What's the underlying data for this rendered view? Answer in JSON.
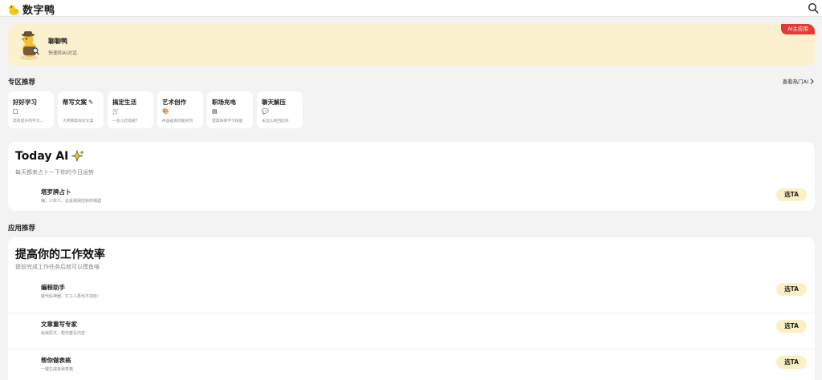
{
  "header": {
    "brand": "数字鸭",
    "logo_icon": "duck-logo-icon",
    "search_icon": "search-icon"
  },
  "banner": {
    "title": "聊聊鸭",
    "subtitle": "快速和AI对话",
    "badge": "AI主应用",
    "avatar_icon": "duck-detective-avatar",
    "background": "#fbf1cf",
    "badge_color": "#e53935"
  },
  "zones_section": {
    "title": "专区推荐",
    "see_more": "查看热门AI",
    "items": [
      {
        "title": "好好学习",
        "icon": "□",
        "desc": "高效提升的学习..."
      },
      {
        "title": "帮写文案",
        "icon": "",
        "title_icon": "✎",
        "desc": "大师教帮你写文案"
      },
      {
        "title": "搞定生活",
        "icon": "🛒",
        "desc": "一会儿吃啥呢?"
      },
      {
        "title": "艺术创作",
        "icon": "🎨",
        "desc": "AI画画真的能好玩"
      },
      {
        "title": "职场充电",
        "icon": "▤",
        "desc": "提高效率学习技能"
      },
      {
        "title": "聊天解压",
        "icon": "💬",
        "desc": "永远认真回应你"
      }
    ]
  },
  "today_card": {
    "title": "Today AI",
    "title_icon": "sparkle-icon",
    "subtitle": "每天都来占卜一下你的今日运势",
    "apps": [
      {
        "name": "塔罗牌占卜",
        "desc": "嗨，少年人，这是我探控和你相遇",
        "button": "选TA"
      }
    ]
  },
  "apps_section": {
    "title": "应用推荐"
  },
  "efficiency_card": {
    "title": "提高你的工作效率",
    "subtitle": "提前完成工作任务后就可以摸鱼咯",
    "apps": [
      {
        "name": "编程助手",
        "desc": "敲代码神器，打工人再也不加班!",
        "button": "选TA"
      },
      {
        "name": "文章重写专家",
        "desc": "给我原文，帮你重写内容",
        "button": "选TA"
      },
      {
        "name": "帮你做表格",
        "desc": "一键生成各种表格",
        "button": "选TA"
      }
    ]
  }
}
